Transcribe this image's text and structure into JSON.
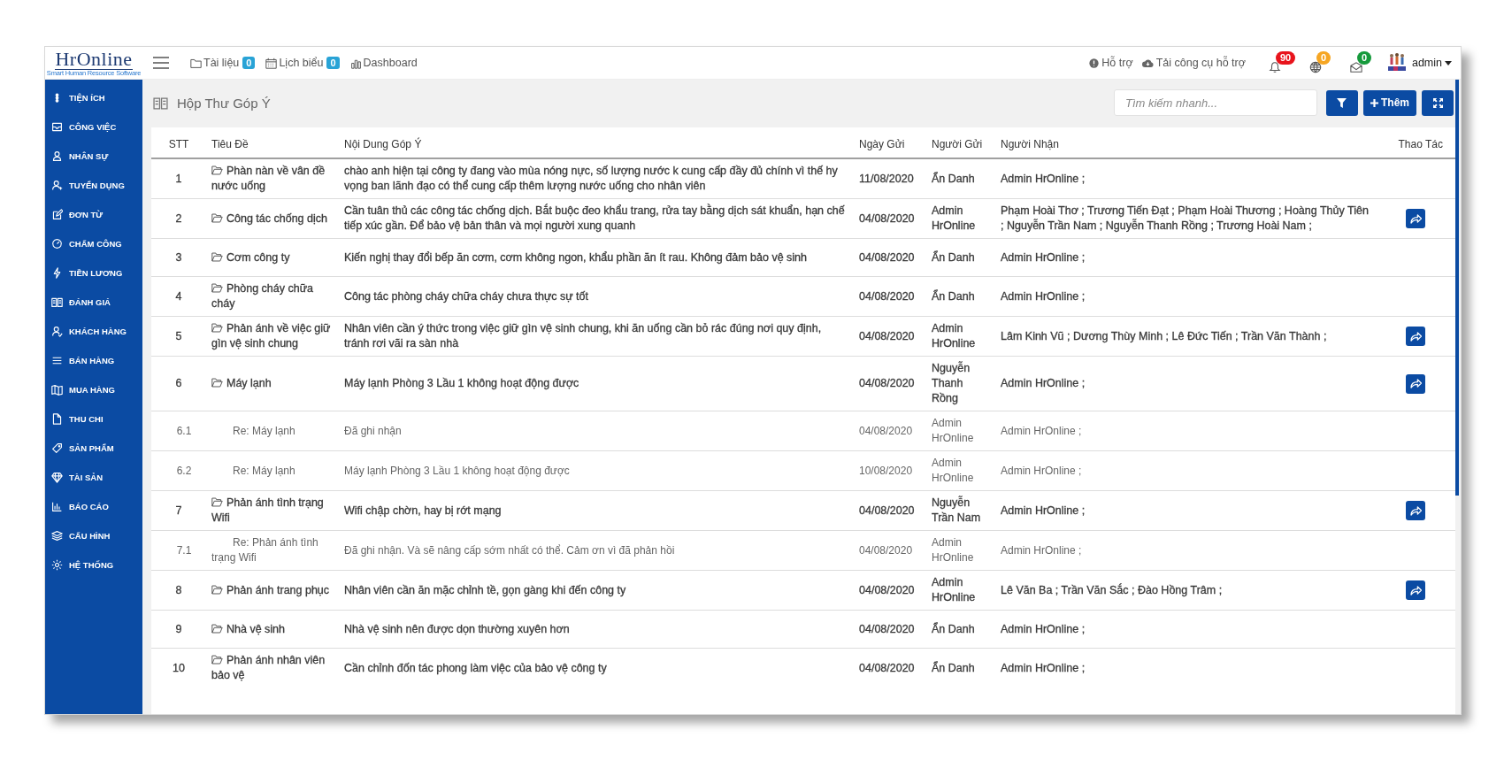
{
  "logo": {
    "name": "HrOnline",
    "tagline": "Smart Human Resource Software"
  },
  "nav": [
    {
      "label": "Tài liệu",
      "badge": "0"
    },
    {
      "label": "Lịch biểu",
      "badge": "0"
    },
    {
      "label": "Dashboard"
    }
  ],
  "support_links": [
    "Hỗ trợ",
    "Tải công cụ hỗ trợ"
  ],
  "notifications": [
    {
      "count": "90",
      "color": "#e8141c"
    },
    {
      "count": "0",
      "color": "#f6a623"
    },
    {
      "count": "0",
      "color": "#169a3c"
    }
  ],
  "user": {
    "name": "admin"
  },
  "sidebar": {
    "items": [
      "TIỆN ÍCH",
      "CÔNG VIỆC",
      "NHÂN SỰ",
      "TUYỂN DỤNG",
      "ĐƠN TỪ",
      "CHẤM CÔNG",
      "TIỀN LƯƠNG",
      "ĐÁNH GIÁ",
      "KHÁCH HÀNG",
      "BÁN HÀNG",
      "MUA HÀNG",
      "THU CHI",
      "SẢN PHẨM",
      "TÀI SẢN",
      "BÁO CÁO",
      "CẤU HÌNH",
      "HỆ THỐNG"
    ]
  },
  "page": {
    "title": "Hộp Thư Góp Ý"
  },
  "search": {
    "placeholder": "Tìm kiếm nhanh..."
  },
  "toolbar": {
    "add_label": "Thêm"
  },
  "table": {
    "columns": [
      "STT",
      "Tiêu Đề",
      "Nội Dung Góp Ý",
      "Ngày Gửi",
      "Người Gửi",
      "Người Nhận",
      "Thao Tác"
    ],
    "rows": [
      {
        "kind": "topic",
        "stt": "1",
        "title": "Phàn nàn về vân đề nước uống",
        "content": "chào anh hiện tại công ty đang vào mùa nóng nực, số lượng nước k cung cấp đầy đủ chính vì thế hy vọng ban lãnh đạo có thể cung cấp thêm lượng nước uống cho nhân viên",
        "date": "11/08/2020",
        "sender": "Ẩn Danh",
        "recipients": "Admin HrOnline ;",
        "forward": false
      },
      {
        "kind": "topic",
        "stt": "2",
        "title": "Công tác chống dịch",
        "content": "Cần tuân thủ các công tác chống dịch. Bắt buộc đeo khẩu trang, rửa tay bằng dịch sát khuẩn, hạn chế tiếp xúc gần. Để bảo vệ bản thân và mọi người xung quanh",
        "date": "04/08/2020",
        "sender": "Admin HrOnline",
        "recipients": "Phạm Hoài Thơ ; Trương Tiến Đạt ; Phạm Hoài Thương ; Hoàng Thủy Tiên ; Nguyễn Trần Nam ; Nguyễn Thanh Rồng ; Trương Hoài Nam ;",
        "forward": true
      },
      {
        "kind": "topic",
        "stt": "3",
        "title": "Cơm công ty",
        "content": "Kiến nghị thay đổi bếp ăn cơm, cơm không ngon, khẩu phần ăn ít rau. Không đảm bảo vệ sinh",
        "date": "04/08/2020",
        "sender": "Ẩn Danh",
        "recipients": "Admin HrOnline ;",
        "forward": false
      },
      {
        "kind": "topic",
        "stt": "4",
        "title": "Phòng cháy chữa cháy",
        "content": "Công tác phòng cháy chữa cháy chưa thực sự tốt",
        "date": "04/08/2020",
        "sender": "Ẩn Danh",
        "recipients": "Admin HrOnline ;",
        "forward": false
      },
      {
        "kind": "topic",
        "stt": "5",
        "title": "Phản ánh về việc giữ gìn vệ sinh chung",
        "content": "Nhân viên cần ý thức trong việc giữ gìn vệ sinh chung, khi ăn uống cần bỏ rác đúng nơi quy định, tránh rơi vãi ra sàn nhà",
        "date": "04/08/2020",
        "sender": "Admin HrOnline",
        "recipients": "Lâm Kinh Vũ ; Dương Thùy Minh ; Lê Đức Tiến ; Trần Văn Thành ;",
        "forward": true
      },
      {
        "kind": "topic",
        "stt": "6",
        "title": "Máy lạnh",
        "content": "Máy lạnh Phòng 3 Lầu 1 không hoạt động được",
        "date": "04/08/2020",
        "sender": "Nguyễn Thanh Rồng",
        "recipients": "Admin HrOnline ;",
        "forward": true
      },
      {
        "kind": "reply",
        "stt": "6.1",
        "title": "Re: Máy lạnh",
        "content": "Đã ghi nhận",
        "date": "04/08/2020",
        "sender": "Admin HrOnline",
        "recipients": "Admin HrOnline ;",
        "forward": false
      },
      {
        "kind": "reply",
        "stt": "6.2",
        "title": "Re: Máy lạnh",
        "content": "Máy lạnh Phòng 3 Lầu 1 không hoạt động được",
        "date": "10/08/2020",
        "sender": "Admin HrOnline",
        "recipients": "Admin HrOnline ;",
        "forward": false
      },
      {
        "kind": "topic",
        "stt": "7",
        "title": "Phản ánh tình trạng Wifi",
        "content": "Wifi chập chờn, hay bị rớt mạng",
        "date": "04/08/2020",
        "sender": "Nguyễn Trần Nam",
        "recipients": "Admin HrOnline ;",
        "forward": true
      },
      {
        "kind": "reply",
        "stt": "7.1",
        "title": "Re: Phản ánh tình trạng Wifi",
        "content": "Đã ghi nhận. Và sẽ nâng cấp sớm nhất có thể. Cảm ơn vì đã phản hồi",
        "date": "04/08/2020",
        "sender": "Admin HrOnline",
        "recipients": "Admin HrOnline ;",
        "forward": false
      },
      {
        "kind": "topic",
        "stt": "8",
        "title": "Phản ánh trang phục",
        "content": "Nhân viên cần ăn mặc chỉnh tề, gọn gàng khi đến công ty",
        "date": "04/08/2020",
        "sender": "Admin HrOnline",
        "recipients": "Lê Văn Ba ; Trần Văn Sắc ; Đào Hồng Trâm ;",
        "forward": true
      },
      {
        "kind": "topic",
        "stt": "9",
        "title": "Nhà vệ sinh",
        "content": "Nhà vệ sinh nên được dọn thường xuyên hơn",
        "date": "04/08/2020",
        "sender": "Ẩn Danh",
        "recipients": "Admin HrOnline ;",
        "forward": false
      },
      {
        "kind": "topic",
        "stt": "10",
        "title": "Phản ánh nhân viên bảo vệ",
        "content": "Cần chỉnh đốn tác phong làm việc của bảo vệ công ty",
        "date": "04/08/2020",
        "sender": "Ẩn Danh",
        "recipients": "Admin HrOnline ;",
        "forward": false
      }
    ]
  }
}
